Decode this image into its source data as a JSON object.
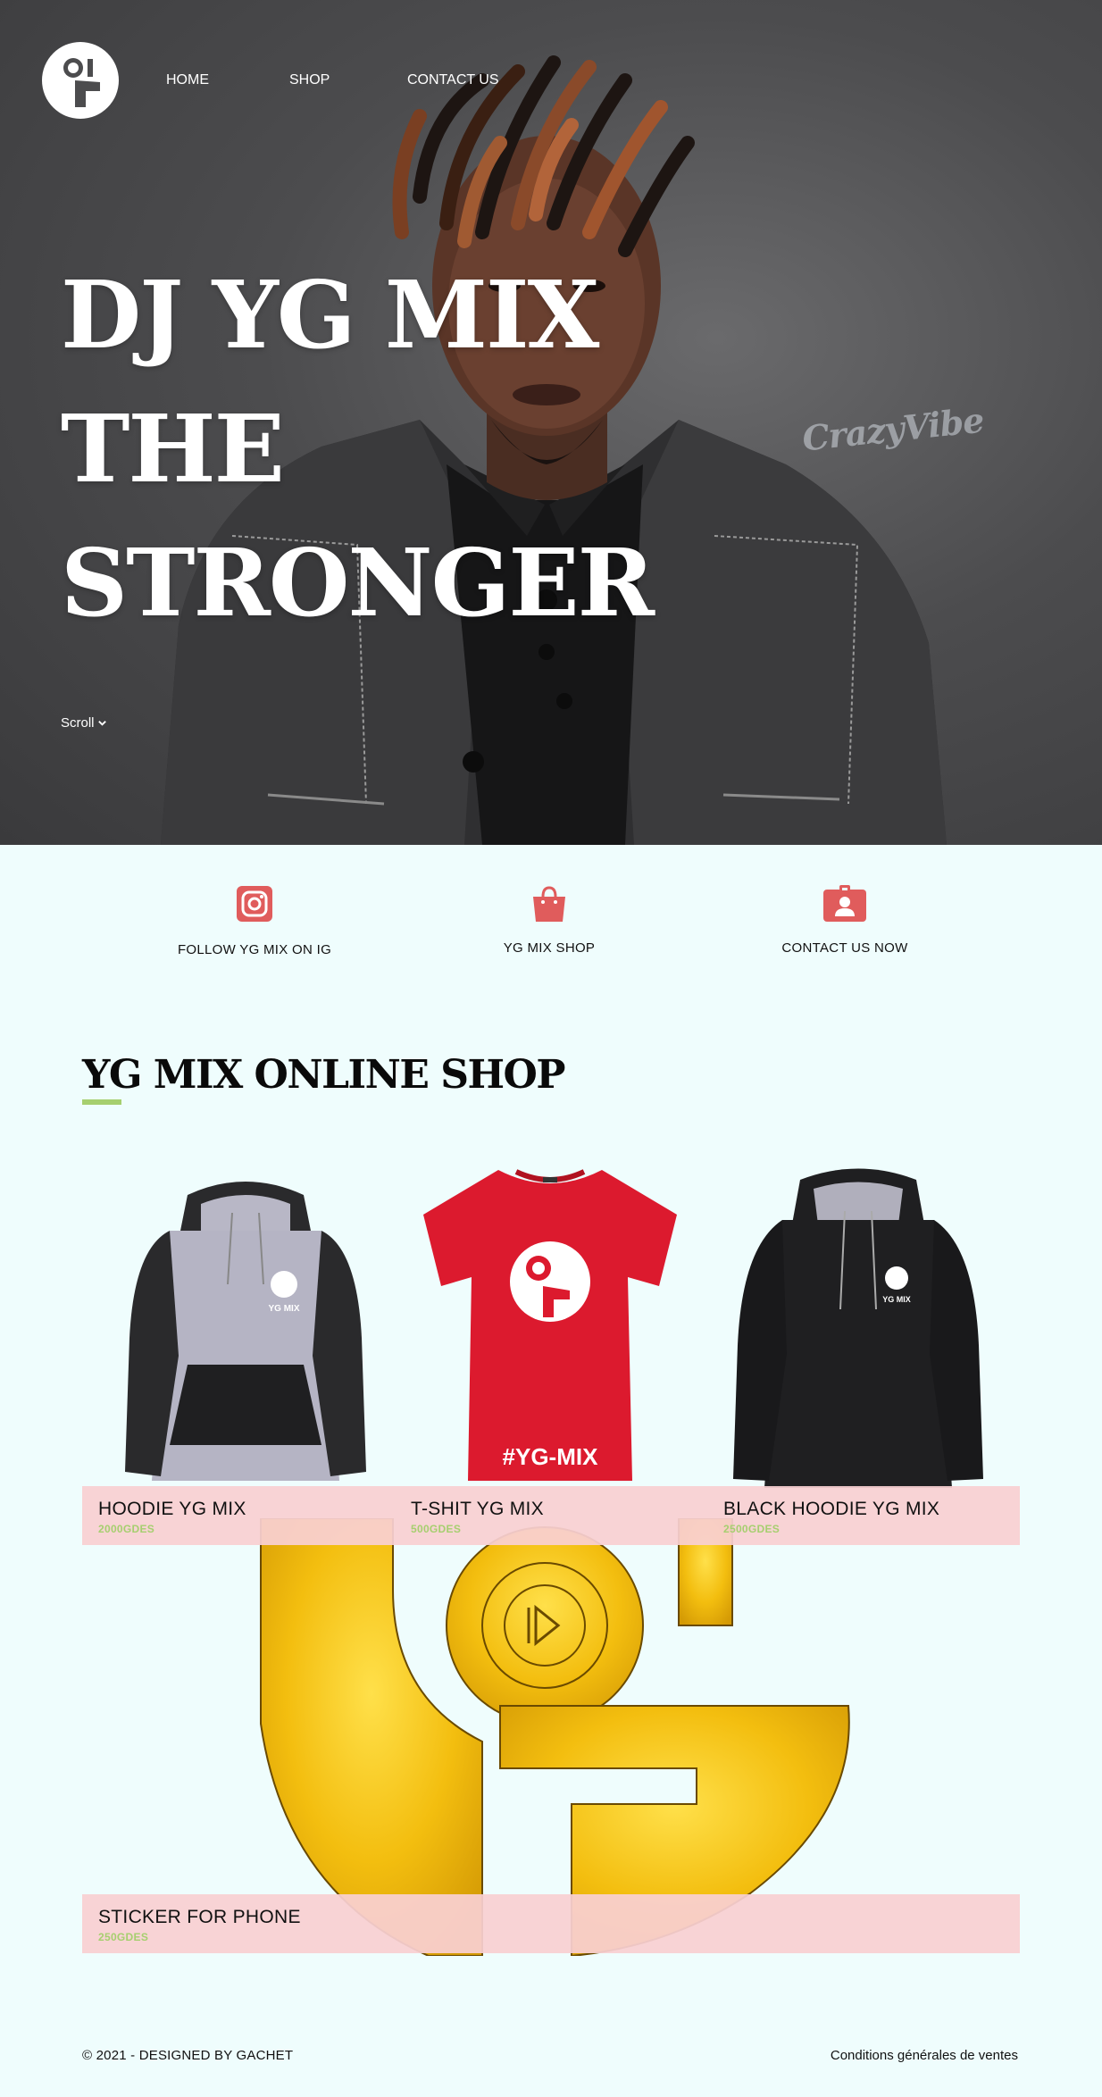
{
  "nav": {
    "items": [
      {
        "label": "HOME"
      },
      {
        "label": "SHOP"
      },
      {
        "label": "CONTACT US"
      }
    ]
  },
  "hero": {
    "lines": [
      "DJ YG MIX",
      "THE",
      "STRONGER"
    ],
    "watermark": "CrazyVibe",
    "scroll_label": "Scroll"
  },
  "features": [
    {
      "label": "FOLLOW YG MIX ON IG",
      "icon": "instagram-icon"
    },
    {
      "label": "YG MIX SHOP",
      "icon": "shopping-bag-icon"
    },
    {
      "label": "CONTACT US NOW",
      "icon": "contact-badge-icon"
    }
  ],
  "shop": {
    "title": "YG MIX ONLINE SHOP",
    "products": [
      {
        "name": "HOODIE YG MIX",
        "price": "2000GDES"
      },
      {
        "name": "T-SHIT YG MIX",
        "price": "500GDES",
        "print": "#YG-MIX"
      },
      {
        "name": "BLACK HOODIE YG MIX",
        "price": "2500GDES",
        "print": "YG MIX"
      },
      {
        "name": "STICKER FOR PHONE",
        "price": "250GDES"
      }
    ]
  },
  "colors": {
    "background": "#effdfd",
    "accent_red": "#e05c5c",
    "accent_green": "#a6cf6f",
    "caption_bg": "#f9d0d2"
  },
  "footer": {
    "copyright": "© 2021 - DESIGNED BY GACHET",
    "terms": "Conditions générales de ventes"
  }
}
